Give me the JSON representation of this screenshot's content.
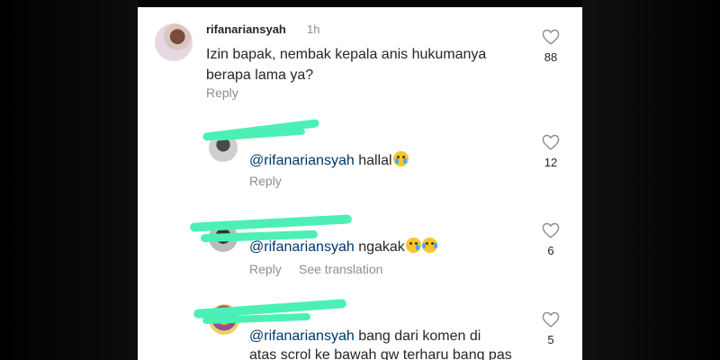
{
  "comments": [
    {
      "username": "rifanariansyah",
      "time": "1h",
      "text": "Izin bapak, nembak kepala anis hukumanya berapa lama ya?",
      "line1": "Izin bapak, nembak kepala anis hukumanya",
      "line2": "berapa lama ya?",
      "reply_label": "Reply",
      "likes": "88"
    },
    {
      "mention": "@rifanariansyah",
      "text": "hallal",
      "emoji": [
        "loudly-crying-face"
      ],
      "reply_label": "Reply",
      "likes": "12"
    },
    {
      "mention": "@rifanariansyah",
      "text": "ngakak",
      "emoji": [
        "crying-face",
        "tears-of-joy-face"
      ],
      "reply_label": "Reply",
      "see_translation_label": "See translation",
      "likes": "6"
    },
    {
      "mention": "@rifanariansyah",
      "line1": "bang dari komen di",
      "line2": "atas scrol ke bawah gw terharu bang pas",
      "likes": "5"
    }
  ],
  "colors": {
    "redaction": "#4cf0b5",
    "mention": "#00376b",
    "muted": "#8e8e8e"
  },
  "icons": [
    "heart-icon"
  ]
}
